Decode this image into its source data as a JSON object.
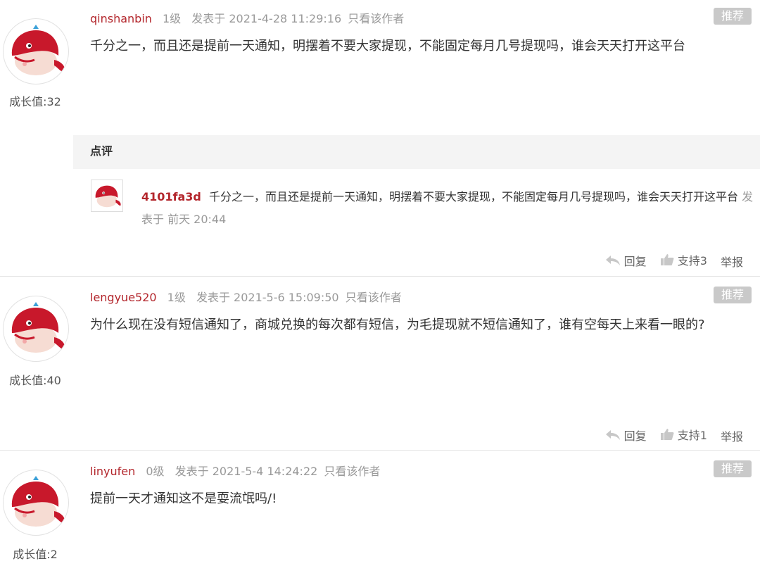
{
  "posts": [
    {
      "username": "qinshanbin",
      "level": "1级",
      "posted_at": "发表于 2021-4-28 11:29:16",
      "only_author": "只看该作者",
      "recommend": "推荐",
      "content": "千分之一，而且还是提前一天通知，明摆着不要大家提现，不能固定每月几号提现吗，谁会天天打开这平台",
      "growth": "成长值:32",
      "review": {
        "header": "点评",
        "username": "4101fa3d",
        "text": "千分之一，而且还是提前一天通知，明摆着不要大家提现，不能固定每月几号提现吗，谁会天天打开这平台",
        "time": "发表于 前天 20:44"
      },
      "reply": "回复",
      "support": "支持3",
      "report": "举报"
    },
    {
      "username": "lengyue520",
      "level": "1级",
      "posted_at": "发表于 2021-5-6 15:09:50",
      "only_author": "只看该作者",
      "recommend": "推荐",
      "content": "为什么现在没有短信通知了，商城兑换的每次都有短信，为毛提现就不短信通知了，谁有空每天上来看一眼的?",
      "growth": "成长值:40",
      "reply": "回复",
      "support": "支持1",
      "report": "举报"
    },
    {
      "username": "linyufen",
      "level": "0级",
      "posted_at": "发表于 2021-5-4 14:24:22",
      "only_author": "只看该作者",
      "recommend": "推荐",
      "content": "提前一天才通知这不是耍流氓吗/!",
      "growth": "成长值:2"
    }
  ],
  "icons": {
    "avatar": "red-whale-avatar-icon",
    "reply": "reply-arrow-icon",
    "support": "thumbs-up-icon"
  },
  "colors": {
    "username": "#b3262c",
    "recommend_bg": "#c9c9c9",
    "review_header_bg": "#f4f4f4"
  }
}
